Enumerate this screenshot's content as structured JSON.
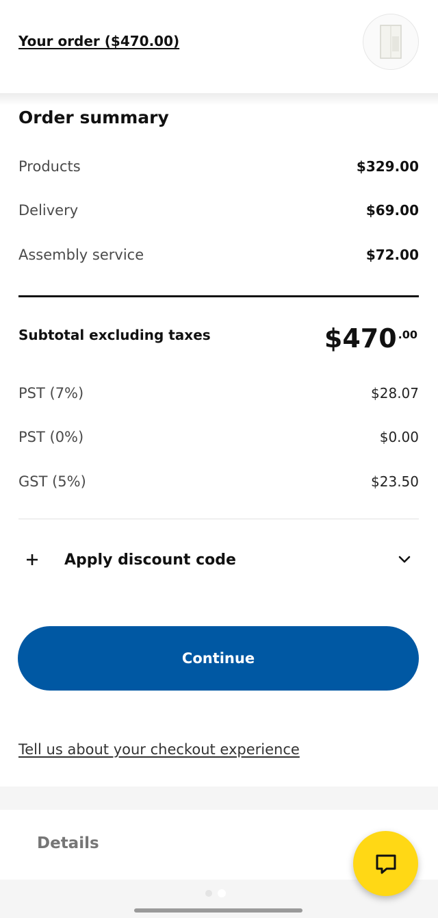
{
  "header": {
    "order_link": "Your order ($470.00)",
    "thumbnail_icon": "wardrobe-product-icon"
  },
  "summary": {
    "title": "Order summary",
    "items": [
      {
        "label": "Products",
        "value": "$329.00"
      },
      {
        "label": "Delivery",
        "value": "$69.00"
      },
      {
        "label": "Assembly service",
        "value": "$72.00"
      }
    ],
    "subtotal": {
      "label": "Subtotal excluding taxes",
      "amount_main": "$470",
      "amount_cents": ".00"
    },
    "taxes": [
      {
        "label": "PST (7%)",
        "value": "$28.07"
      },
      {
        "label": "PST (0%)",
        "value": "$0.00"
      },
      {
        "label": "GST (5%)",
        "value": "$23.50"
      }
    ]
  },
  "discount": {
    "label": "Apply discount code",
    "icon": "plus-icon",
    "toggle_icon": "chevron-down-icon"
  },
  "actions": {
    "continue_label": "Continue",
    "feedback_link": "Tell us about your checkout experience"
  },
  "footer": {
    "details_label": "Details",
    "chat_icon": "chat-bubble-icon"
  },
  "colors": {
    "primary_button": "#0058a3",
    "chat_button": "#ffd815",
    "background_band": "#f5f5f5"
  }
}
